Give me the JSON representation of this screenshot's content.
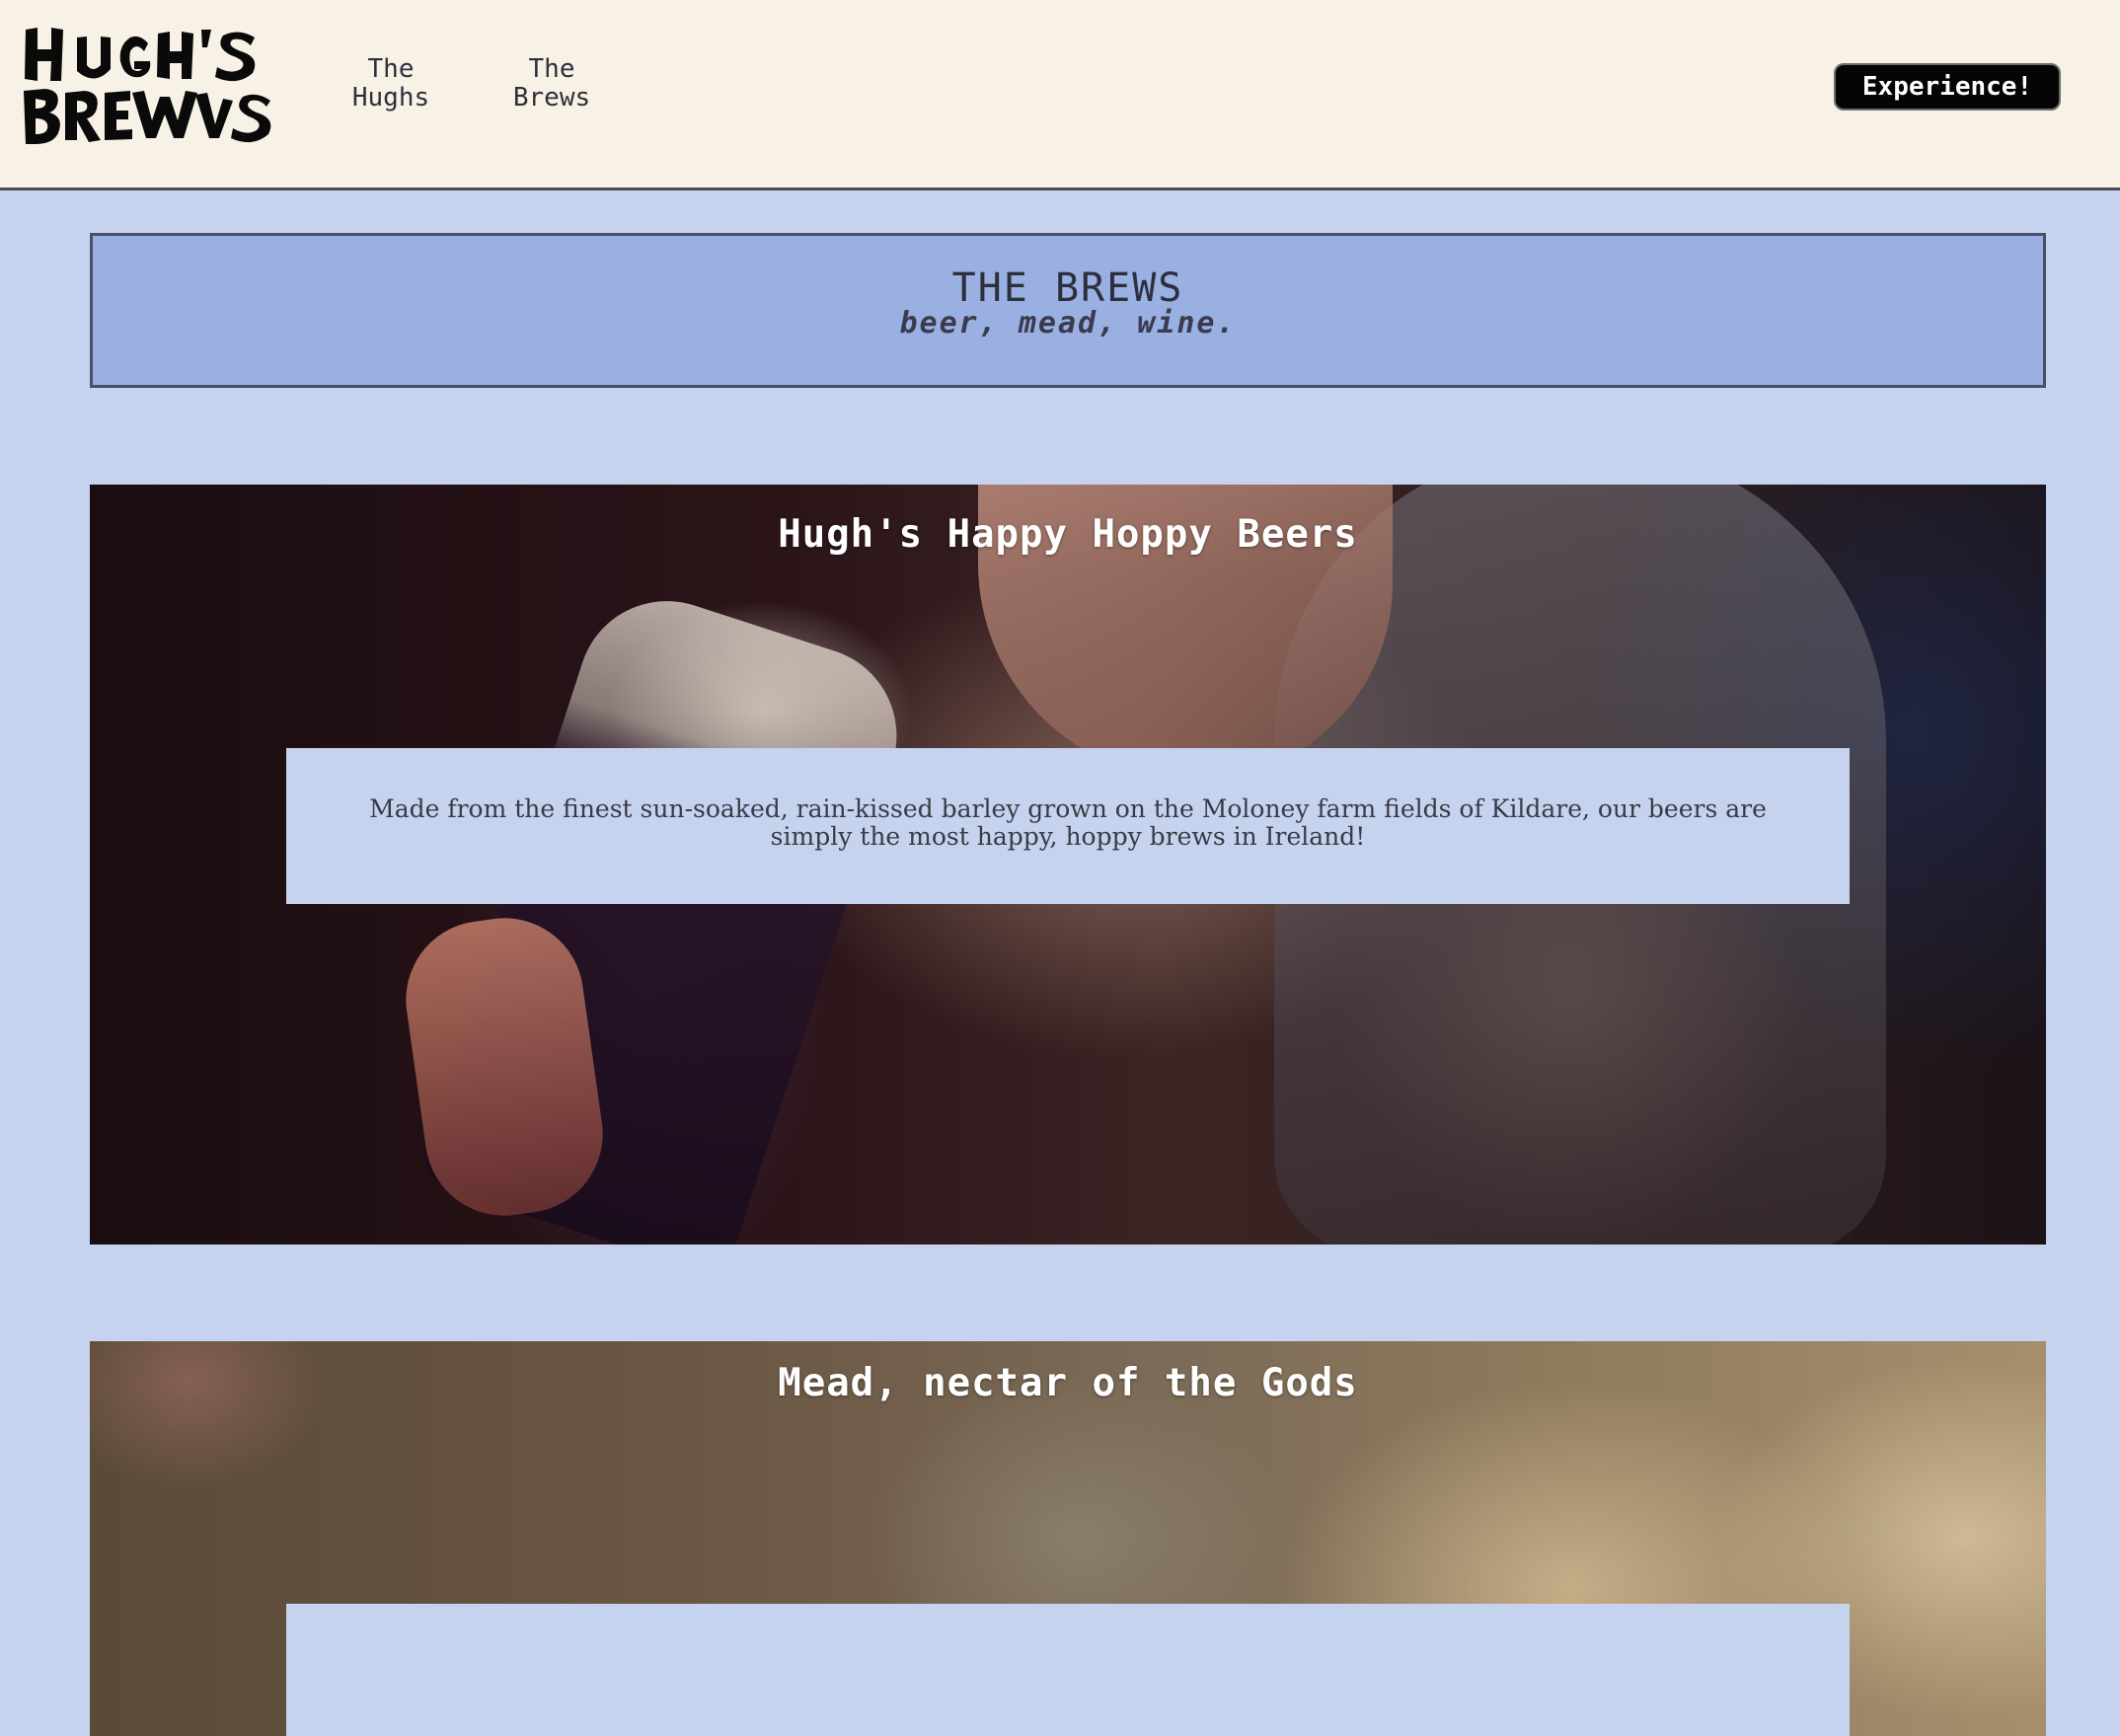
{
  "header": {
    "logo_text": "HUGH'S BREWS",
    "nav": [
      {
        "line1": "The",
        "line2": "Hughs"
      },
      {
        "line1": "The",
        "line2": "Brews"
      }
    ],
    "cta_label": "Experience!"
  },
  "banner": {
    "title": "THE BREWS",
    "subtitle": "beer, mead, wine."
  },
  "products": [
    {
      "title": "Hugh's Happy Hoppy Beers",
      "description": "Made from the finest sun-soaked, rain-kissed barley grown on the Moloney farm fields of Kildare, our beers are simply the most happy, hoppy brews in Ireland!"
    },
    {
      "title": "Mead, nectar of the Gods",
      "description": ""
    }
  ],
  "colors": {
    "header_bg": "#f8f1e5",
    "page_bg": "#c5d3ef",
    "banner_bg": "#9ab0e3",
    "cta_bg": "#050505"
  }
}
